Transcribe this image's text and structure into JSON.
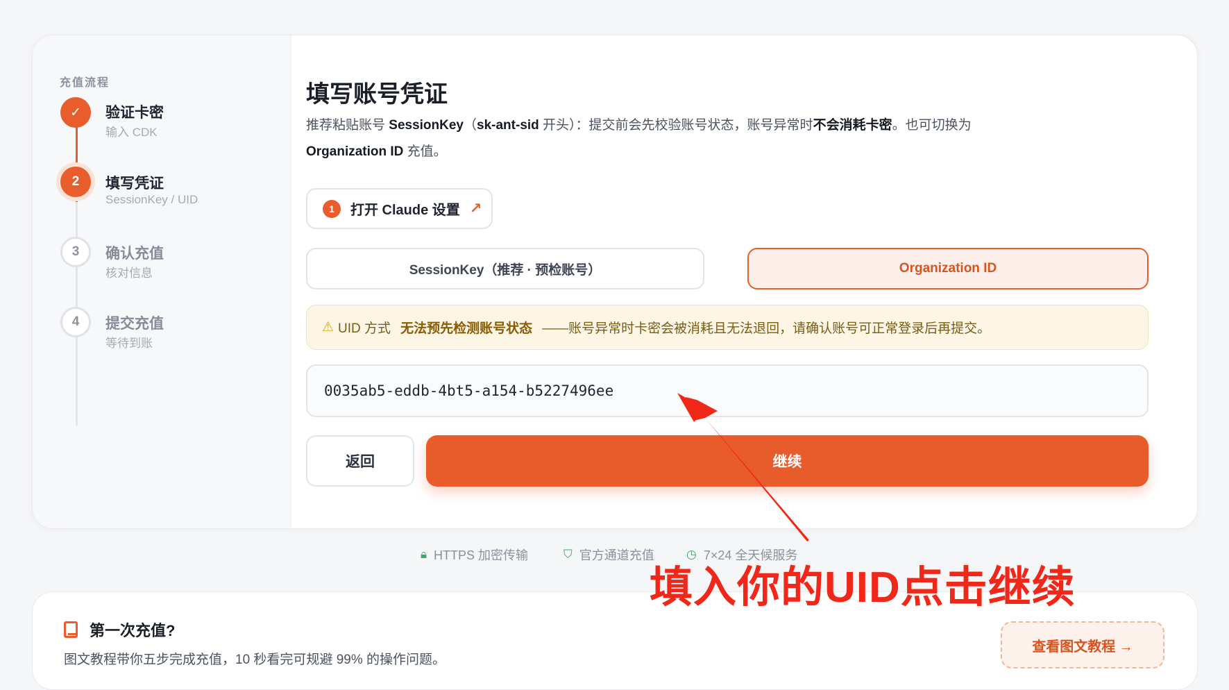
{
  "sidebar": {
    "title": "充值流程",
    "steps": [
      {
        "badge": "✓",
        "name": "验证卡密",
        "sub": "输入 CDK",
        "state": "done"
      },
      {
        "badge": "2",
        "name": "填写凭证",
        "sub": "SessionKey / UID",
        "state": "active"
      },
      {
        "badge": "3",
        "name": "确认充值",
        "sub": "核对信息",
        "state": "todo"
      },
      {
        "badge": "4",
        "name": "提交充值",
        "sub": "等待到账",
        "state": "todo"
      }
    ]
  },
  "main": {
    "title": "填写账号凭证",
    "desc": {
      "p1": "推荐粘贴账号 ",
      "b1": "SessionKey",
      "p2": "（",
      "b2": "sk-ant-sid",
      "p3": " 开头）：提交前会先校验账号状态，账号异常时",
      "b3": "不会消耗卡密",
      "p4": "。也可切换为 ",
      "b4": "Organization ID",
      "p5": " 充值。"
    },
    "open_button": {
      "badge": "1",
      "label": "打开 Claude 设置",
      "icon": "external-link-icon"
    },
    "tabs": [
      {
        "label": "SessionKey（推荐 · 预检账号）",
        "selected": false
      },
      {
        "label": "Organization ID",
        "selected": true
      }
    ],
    "warning": {
      "icon": "⚠",
      "lead": "UID 方式",
      "strong": "无法预先检测账号状态",
      "rest": "——账号异常时卡密会被消耗且无法退回，请确认账号可正常登录后再提交。"
    },
    "uid_input": {
      "value": "0035ab5-eddb-4bt5-a154-b5227496ee"
    },
    "back_label": "返回",
    "continue_label": "继续"
  },
  "trust": [
    {
      "icon": "lock-icon",
      "label": "HTTPS 加密传输"
    },
    {
      "icon": "shield-icon",
      "label": "官方通道充值"
    },
    {
      "icon": "clock-icon",
      "label": "7×24 全天候服务"
    }
  ],
  "tutorial": {
    "title": "第一次充值?",
    "desc": "图文教程带你五步完成充值，10 秒看完可规避 99% 的操作问题。",
    "button_label": "查看图文教程 →"
  },
  "annotation": {
    "caption": "填入你的UID点击继续",
    "color": "#f0281a"
  },
  "colors": {
    "accent": "#e85d2b",
    "warning_bg": "#fdf6e6",
    "trust_icon": "#3aa86b"
  }
}
